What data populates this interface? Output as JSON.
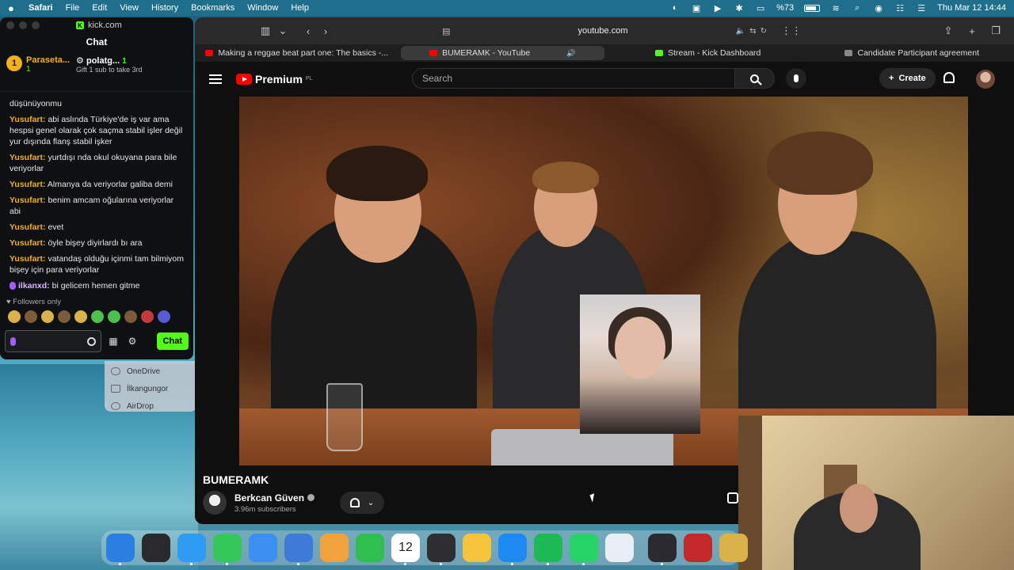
{
  "menubar": {
    "app": "Safari",
    "items": [
      "File",
      "Edit",
      "View",
      "History",
      "Bookmarks",
      "Window",
      "Help"
    ],
    "battery_percent": "%73",
    "datetime": "Thu Mar 12  14:44"
  },
  "kick": {
    "url": "kick.com",
    "panel_title": "Chat",
    "leaders": [
      {
        "rank": "1",
        "name": "Paraseta...",
        "count": "1"
      },
      {
        "name": "polatg...",
        "count": "1",
        "note": "Gift 1 sub to take 3rd"
      }
    ],
    "messages": [
      {
        "user": "",
        "text": "düşünüyonmu"
      },
      {
        "user": "Yusufart:",
        "text": "abi aslında Türkiye'de iş var ama hespsi genel olarak çok saçma stabil işler değil yur dışında flanş stabil işker"
      },
      {
        "user": "Yusufart:",
        "text": "yurtdışı nda okul okuyana para bile veriyorlar"
      },
      {
        "user": "Yusufart:",
        "text": "Almanya da veriyorlar galiba demi"
      },
      {
        "user": "Yusufart:",
        "text": "benim amcam oğularına veriyorlar abi"
      },
      {
        "user": "Yusufart:",
        "text": "evet"
      },
      {
        "user": "Yusufart:",
        "text": "öyle bişey diyirlardı bı ara"
      },
      {
        "user": "Yusufart:",
        "text": "vatandaş olduğu içinmi tam bilmiyom bişey için para veriyorlar"
      },
      {
        "user": "ilkanxd:",
        "text": "bi gelicem hemen gitme"
      }
    ],
    "followers_only": "Followers only",
    "send_label": "Chat"
  },
  "finder": {
    "items": [
      "OneDrive",
      "İlkangungor",
      "AirDrop"
    ]
  },
  "safari": {
    "url": "youtube.com",
    "tabs": [
      {
        "title": "Making a reggae beat part one: The basics -...",
        "favicon": "yt"
      },
      {
        "title": "BUMERAMK - YouTube",
        "favicon": "yt",
        "active": true
      },
      {
        "title": "Stream - Kick Dashboard",
        "favicon": "kick"
      },
      {
        "title": "Candidate Participant agreement",
        "favicon": "gray"
      }
    ]
  },
  "youtube": {
    "logo_text": "Premium",
    "logo_region": "PL",
    "search_placeholder": "Search",
    "create_label": "Create",
    "video_title": "BUMERAMK",
    "channel_name": "Berkcan Güven",
    "subscribers": "3.96m subscribers"
  },
  "dock": {
    "apps": [
      {
        "name": "finder",
        "color": "#2b7fe0",
        "label": ""
      },
      {
        "name": "launchpad",
        "color": "#2a2a2e",
        "label": ""
      },
      {
        "name": "safari",
        "color": "#2f9cf2",
        "label": ""
      },
      {
        "name": "messages",
        "color": "#35c759",
        "label": ""
      },
      {
        "name": "mail",
        "color": "#3a8ff0",
        "label": ""
      },
      {
        "name": "app-store-alt",
        "color": "#3e7bd9",
        "label": ""
      },
      {
        "name": "photos",
        "color": "#f2a23a",
        "label": ""
      },
      {
        "name": "facetime",
        "color": "#2fbf4f",
        "label": ""
      },
      {
        "name": "calendar",
        "color": "#ffffff",
        "label": "12"
      },
      {
        "name": "reminders",
        "color": "#2e2e32",
        "label": ""
      },
      {
        "name": "notes",
        "color": "#f5c43a",
        "label": ""
      },
      {
        "name": "app-store",
        "color": "#1c8af2",
        "label": ""
      },
      {
        "name": "spotify",
        "color": "#1db954",
        "label": ""
      },
      {
        "name": "whatsapp",
        "color": "#25d366",
        "label": ""
      },
      {
        "name": "files",
        "color": "#e9eef4",
        "label": ""
      },
      {
        "name": "obs",
        "color": "#2a2a30",
        "label": ""
      },
      {
        "name": "recorder",
        "color": "#c22a2a",
        "label": ""
      },
      {
        "name": "misc",
        "color": "#d9b24a",
        "label": ""
      }
    ]
  }
}
